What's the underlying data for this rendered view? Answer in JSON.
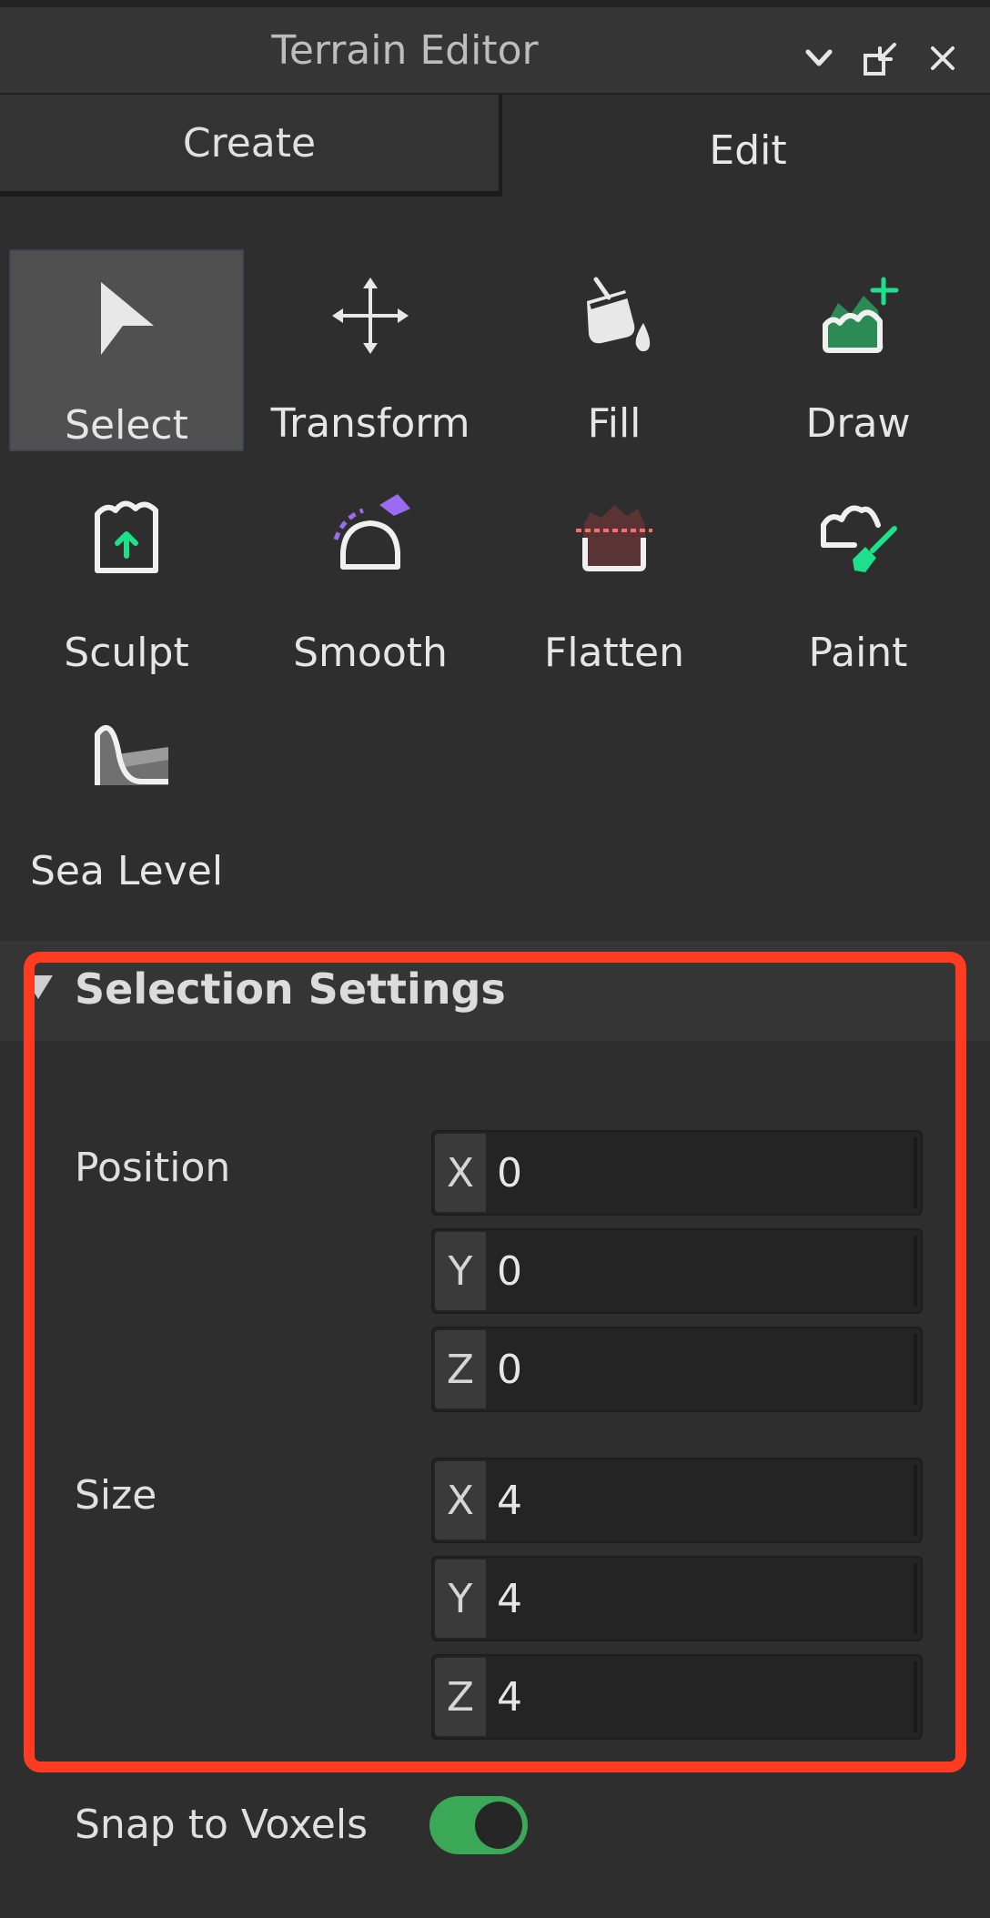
{
  "window": {
    "title": "Terrain Editor",
    "buttons": [
      "chevron-down-icon",
      "dock-icon",
      "close-icon"
    ]
  },
  "tabs": [
    {
      "label": "Create",
      "active": false
    },
    {
      "label": "Edit",
      "active": true
    }
  ],
  "tools": [
    {
      "label": "Select",
      "icon": "select-arrow-icon",
      "selected": true
    },
    {
      "label": "Transform",
      "icon": "move-arrows-icon",
      "selected": false
    },
    {
      "label": "Fill",
      "icon": "paint-bucket-icon",
      "selected": false
    },
    {
      "label": "Draw",
      "icon": "terrain-add-icon",
      "selected": false
    },
    {
      "label": "Sculpt",
      "icon": "terrain-raise-icon",
      "selected": false
    },
    {
      "label": "Smooth",
      "icon": "terrain-smooth-icon",
      "selected": false
    },
    {
      "label": "Flatten",
      "icon": "terrain-flatten-icon",
      "selected": false
    },
    {
      "label": "Paint",
      "icon": "terrain-paint-icon",
      "selected": false
    },
    {
      "label": "Sea Level",
      "icon": "sea-level-icon",
      "selected": false
    }
  ],
  "selection_settings": {
    "title": "Selection Settings",
    "position": {
      "label": "Position",
      "x": {
        "axis": "X",
        "value": "0"
      },
      "y": {
        "axis": "Y",
        "value": "0"
      },
      "z": {
        "axis": "Z",
        "value": "0"
      }
    },
    "size": {
      "label": "Size",
      "x": {
        "axis": "X",
        "value": "4"
      },
      "y": {
        "axis": "Y",
        "value": "4"
      },
      "z": {
        "axis": "Z",
        "value": "4"
      }
    }
  },
  "snap_to_voxels": {
    "label": "Snap to Voxels",
    "enabled": true
  },
  "colors": {
    "background": "#2e2e2e",
    "accent_green": "#3aa856",
    "highlight": "#ff3b22",
    "icon_green": "#1fe08a",
    "icon_purple": "#9b6cf0"
  }
}
